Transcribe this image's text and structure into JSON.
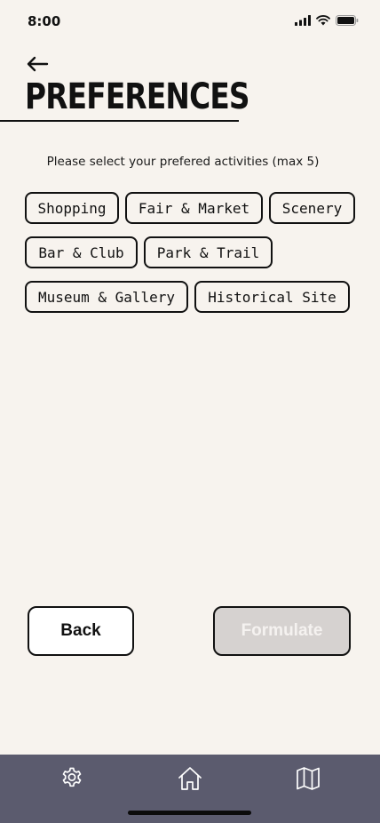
{
  "status_bar": {
    "time": "8:00",
    "icons": [
      "signal-icon",
      "wifi-icon",
      "battery-icon"
    ]
  },
  "header": {
    "back_icon": "back-arrow-icon",
    "title": "PREFERENCES"
  },
  "instruction": "Please select your prefered activities (max 5)",
  "activities": [
    {
      "label": "Shopping"
    },
    {
      "label": "Fair & Market"
    },
    {
      "label": "Scenery"
    },
    {
      "label": "Bar & Club"
    },
    {
      "label": "Park & Trail"
    },
    {
      "label": "Museum & Gallery"
    },
    {
      "label": "Historical Site"
    }
  ],
  "actions": {
    "back_label": "Back",
    "formulate_label": "Formulate",
    "formulate_enabled": false
  },
  "tab_bar": {
    "items": [
      {
        "icon": "gear-icon"
      },
      {
        "icon": "home-icon"
      },
      {
        "icon": "map-icon"
      }
    ],
    "color": "#5b5b6e"
  },
  "colors": {
    "background": "#f7f3ee",
    "text": "#111111",
    "disabled_button": "#d6d2d0"
  }
}
